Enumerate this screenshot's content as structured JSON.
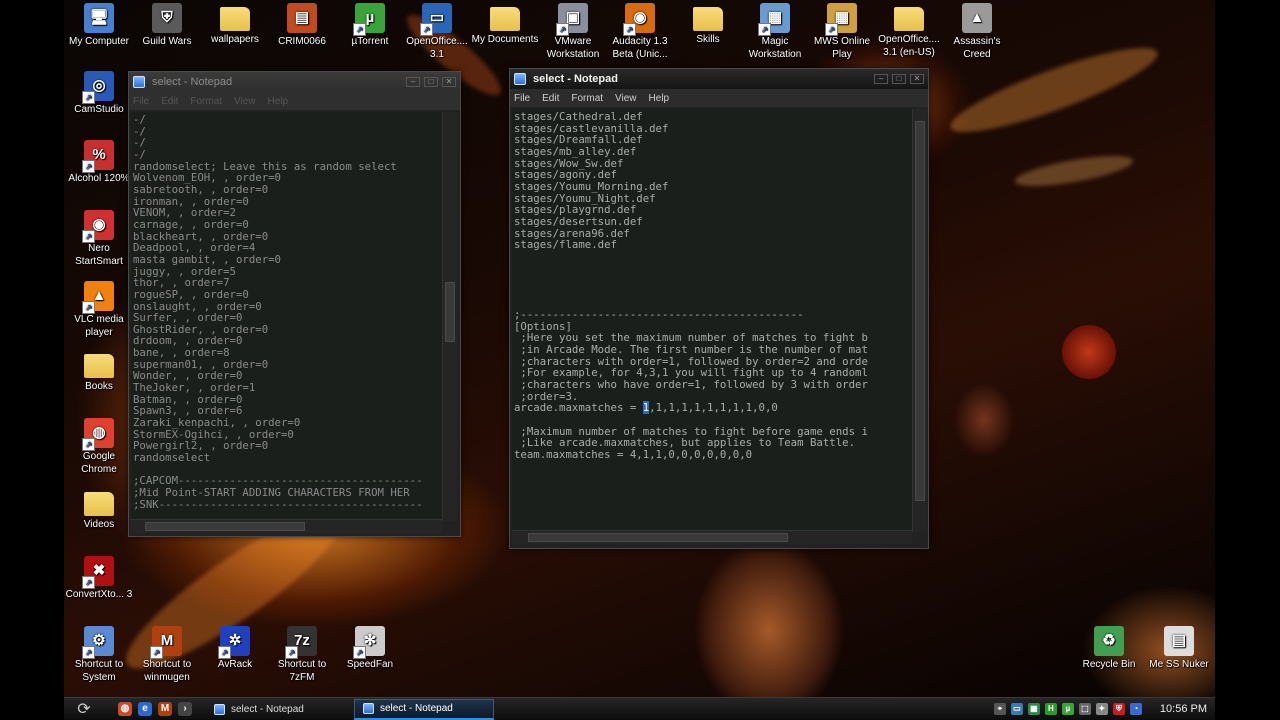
{
  "desktop": {
    "icons": [
      {
        "label": "My Computer",
        "glyph": "🖥",
        "color": "#4a7fd0"
      },
      {
        "label": "Guild Wars",
        "glyph": "⛨",
        "color": "#5a5a5a"
      },
      {
        "label": "wallpapers",
        "glyph": "",
        "color": "#e8c04a"
      },
      {
        "label": "CRIM0066",
        "glyph": "▤",
        "color": "#c24a1f"
      },
      {
        "label": "µTorrent",
        "glyph": "µ",
        "color": "#3aa43a"
      },
      {
        "label": "OpenOffice.... 3.1",
        "glyph": "▭",
        "color": "#2a66b8"
      },
      {
        "label": "My Documents",
        "glyph": "",
        "color": "#e8c04a"
      },
      {
        "label": "VMware Workstation",
        "glyph": "▣",
        "color": "#8a8fa0"
      },
      {
        "label": "Audacity 1.3 Beta (Unic...",
        "glyph": "◉",
        "color": "#d86a10"
      },
      {
        "label": "Skills",
        "glyph": "",
        "color": "#e8c04a"
      },
      {
        "label": "Magic Workstation",
        "glyph": "▦",
        "color": "#6a9ad0"
      },
      {
        "label": "MWS Online Play",
        "glyph": "▦",
        "color": "#d0a040"
      },
      {
        "label": "OpenOffice.... 3.1 (en-US)",
        "glyph": "",
        "color": "#e8c04a"
      },
      {
        "label": "Assassin's Creed",
        "glyph": "▲",
        "color": "#9a9a9a"
      },
      {
        "label": "CamStudio",
        "glyph": "◎",
        "color": "#2a5ab8"
      },
      {
        "label": "Alcohol 120%",
        "glyph": "%",
        "color": "#c83030"
      },
      {
        "label": "Nero StartSmart",
        "glyph": "◉",
        "color": "#d03030"
      },
      {
        "label": "VLC media player",
        "glyph": "▲",
        "color": "#f08010"
      },
      {
        "label": "Books",
        "glyph": "",
        "color": "#e8c04a"
      },
      {
        "label": "Google Chrome",
        "glyph": "◍",
        "color": "#e04030"
      },
      {
        "label": "Videos",
        "glyph": "",
        "color": "#e8c04a"
      },
      {
        "label": "ConvertXto... 3",
        "glyph": "✖",
        "color": "#b01010"
      },
      {
        "label": "Shortcut to System",
        "glyph": "⚙",
        "color": "#5a8ad0"
      },
      {
        "label": "Shortcut to winmugen",
        "glyph": "M",
        "color": "#b04010"
      },
      {
        "label": "AvRack",
        "glyph": "✲",
        "color": "#2040c0"
      },
      {
        "label": "Shortcut to 7zFM",
        "glyph": "7z",
        "color": "#333333"
      },
      {
        "label": "SpeedFan",
        "glyph": "✻",
        "color": "#cccccc"
      },
      {
        "label": "Recycle Bin",
        "glyph": "♻",
        "color": "#40a050"
      },
      {
        "label": "Me SS Nuker",
        "glyph": "▤",
        "color": "#dddddd"
      }
    ]
  },
  "window_left": {
    "title": "select - Notepad",
    "menu": [
      "File",
      "Edit",
      "Format",
      "View",
      "Help"
    ],
    "lines": [
      "-/",
      "-/",
      "-/",
      "-/",
      "randomselect; Leave this as random select",
      "Wolvenom_EOH, , order=0",
      "sabretooth, , order=0",
      "ironman, , order=0",
      "VENOM, , order=2",
      "carnage, , order=0",
      "blackheart, , order=0",
      "Deadpool, , order=4",
      "masta gambit, , order=0",
      "juggy, , order=5",
      "thor, , order=7",
      "rogueSP, , order=0",
      "onslaught, , order=0",
      "Surfer, , order=0",
      "GhostRider, , order=0",
      "drdoom, , order=0",
      "bane, , order=8",
      "superman01, , order=0",
      "Wonder, , order=0",
      "TheJoker, , order=1",
      "Batman, , order=0",
      "Spawn3, , order=6",
      "Zaraki_kenpachi, , order=0",
      "StormEX-Ogihci, , order=0",
      "Powergirl2, , order=0",
      "randomselect",
      "",
      ";CAPCOM--------------------------------------",
      ";Mid Point-START ADDING CHARACTERS FROM HER",
      ";SNK-----------------------------------------"
    ]
  },
  "window_right": {
    "title": "select - Notepad",
    "menu": [
      "File",
      "Edit",
      "Format",
      "View",
      "Help"
    ],
    "lines": [
      "stages/Cathedral.def",
      "stages/castlevanilla.def",
      "stages/Dreamfall.def",
      "stages/mb_alley.def",
      "stages/Wow_Sw.def",
      "stages/agony.def",
      "stages/Youmu_Morning.def",
      "stages/Youmu_Night.def",
      "stages/playgrnd.def",
      "stages/desertsun.def",
      "stages/arena96.def",
      "stages/flame.def",
      "",
      "",
      "",
      "",
      "",
      ";--------------------------------------------",
      "[Options]",
      " ;Here you set the maximum number of matches to fight b",
      " ;in Arcade Mode. The first number is the number of mat",
      " ;characters with order=1, followed by order=2 and orde",
      " ;For example, for 4,3,1 you will fight up to 4 randoml",
      " ;characters who have order=1, followed by 3 with order",
      " ;order=3.",
      "arcade.maxmatches = |1|,1,1,1,1,1,1,1,1,0,0",
      "",
      " ;Maximum number of matches to fight before game ends i",
      " ;Like arcade.maxmatches, but applies to Team Battle.",
      "team.maxmatches = 4,1,1,0,0,0,0,0,0,0"
    ]
  },
  "taskbar": {
    "start_glyph": "⟳",
    "quicklaunch": [
      {
        "glyph": "◍",
        "color": "#d04a2a"
      },
      {
        "glyph": "e",
        "color": "#2a6ad0"
      },
      {
        "glyph": "M",
        "color": "#b04010"
      },
      {
        "glyph": "›",
        "color": "#444444"
      }
    ],
    "buttons": [
      {
        "label": "select - Notepad",
        "active": false
      },
      {
        "label": "select - Notepad",
        "active": true
      }
    ],
    "tray": [
      {
        "glyph": "⌖",
        "color": "#555555"
      },
      {
        "glyph": "▭",
        "color": "#3a7ab0"
      },
      {
        "glyph": "▦",
        "color": "#2a8a4a"
      },
      {
        "glyph": "H",
        "color": "#2a9a2a"
      },
      {
        "glyph": "µ",
        "color": "#3aa43a"
      },
      {
        "glyph": "⬚",
        "color": "#666666"
      },
      {
        "glyph": "✦",
        "color": "#888888"
      },
      {
        "glyph": "⛨",
        "color": "#c02020"
      },
      {
        "glyph": "◔",
        "color": "#3a6ad0"
      }
    ],
    "clock": "10:56 PM"
  }
}
